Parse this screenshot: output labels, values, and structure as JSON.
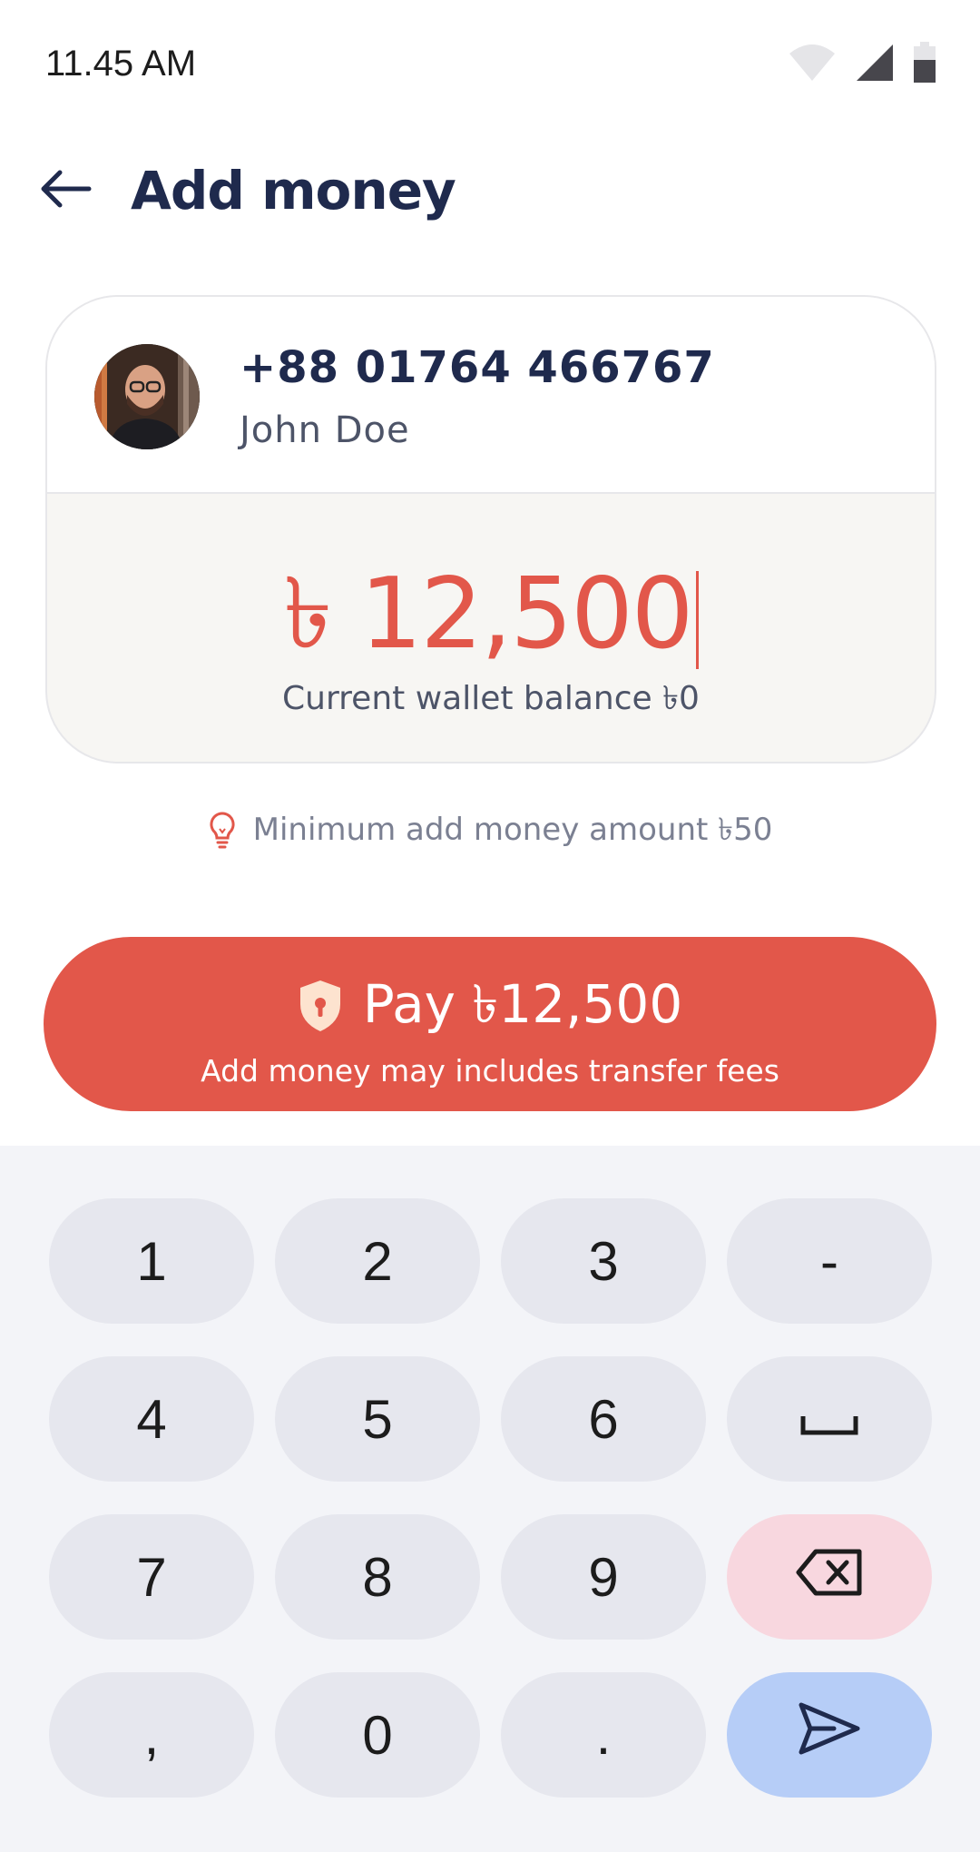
{
  "status_bar": {
    "time": "11.45 AM",
    "icons": [
      "wifi-icon",
      "signal-icon",
      "battery-icon"
    ]
  },
  "header": {
    "back_icon": "arrow-left-icon",
    "title": "Add money"
  },
  "recipient": {
    "phone": "+88 01764 466767",
    "name": "John Doe"
  },
  "amount": {
    "value": "৳ 12,500",
    "wallet_balance": "Current wallet balance ৳0"
  },
  "hint": {
    "icon": "lightbulb-icon",
    "text": "Minimum add money amount ৳50"
  },
  "pay_button": {
    "icon": "shield-lock-icon",
    "label": "Pay ৳12,500",
    "subtext": "Add money may includes transfer fees"
  },
  "keypad": {
    "keys": [
      "1",
      "2",
      "3",
      "-",
      "4",
      "5",
      "6",
      "space",
      "7",
      "8",
      "9",
      "backspace",
      ",",
      "0",
      ".",
      "send"
    ]
  },
  "colors": {
    "accent": "#e2574a",
    "title": "#1f2a4d",
    "keypad_bg": "#f3f4f8",
    "key_bg": "#e6e7ee",
    "delete_key_bg": "#f8d7df",
    "send_key_bg": "#b6cdf7"
  }
}
